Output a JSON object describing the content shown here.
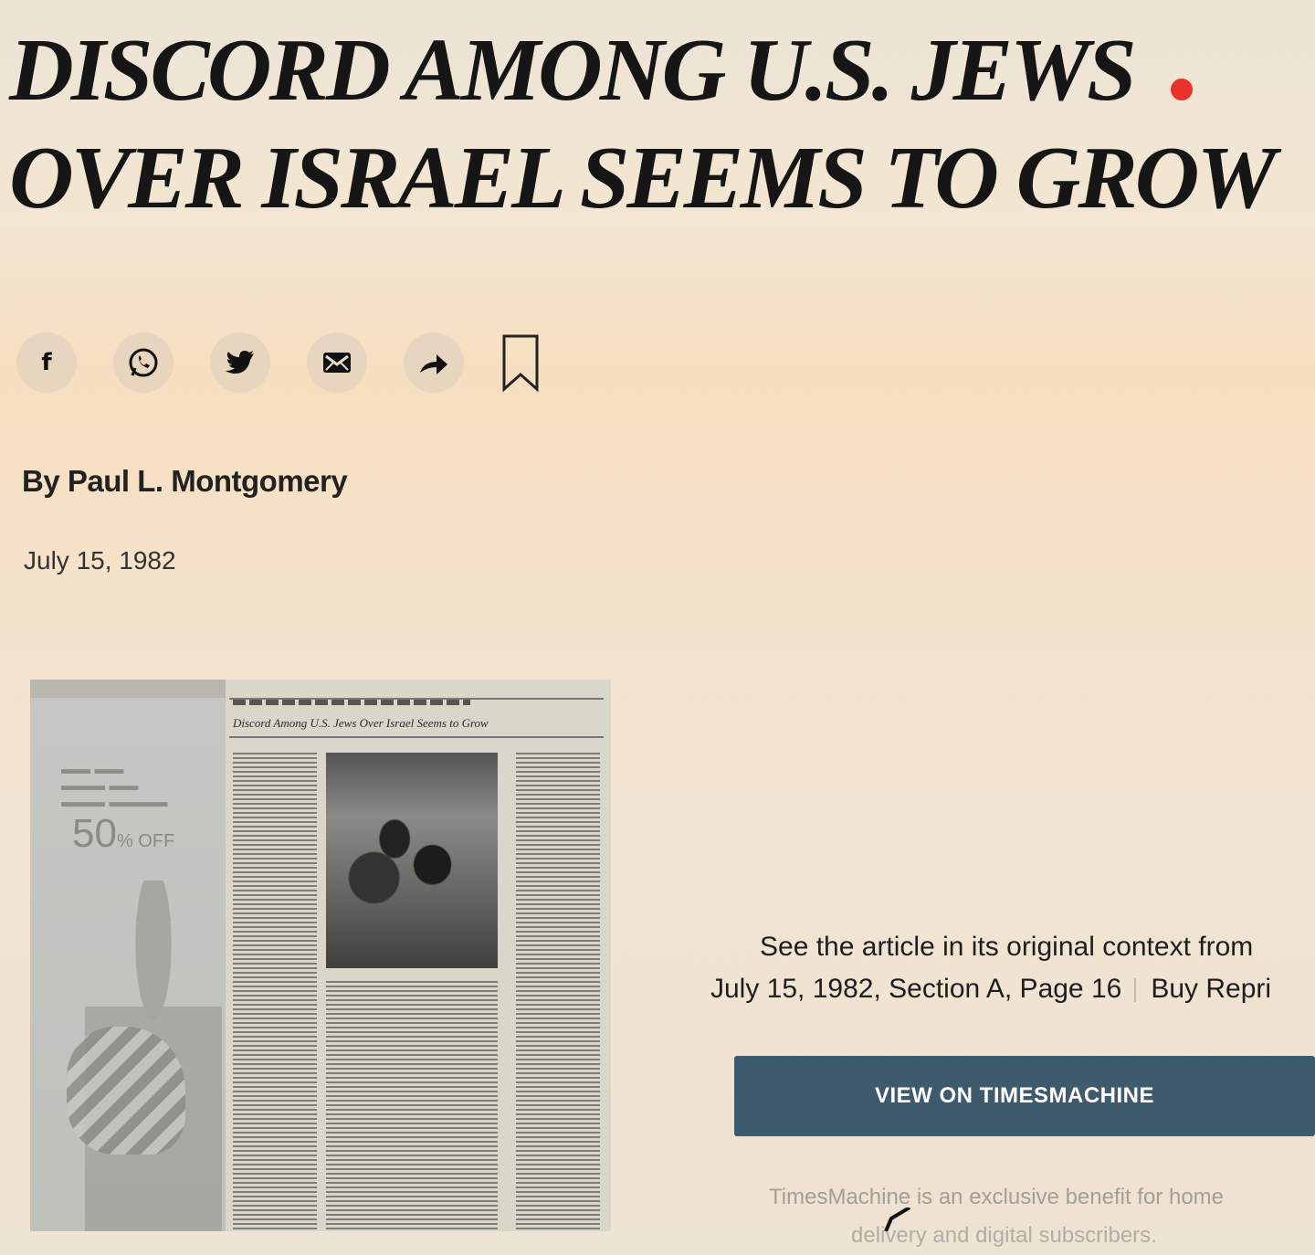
{
  "article": {
    "headline_line1": "DISCORD AMONG U.S. JEWS",
    "headline_line2": "OVER ISRAEL SEEMS TO GROW",
    "byline": "By Paul L. Montgomery",
    "date": "July 15, 1982"
  },
  "share": {
    "facebook_glyph": "f",
    "icons": [
      "facebook-icon",
      "whatsapp-icon",
      "twitter-icon",
      "email-icon",
      "share-arrow-icon",
      "bookmark-icon"
    ]
  },
  "scan": {
    "ad_text": "50",
    "ad_small": "% OFF",
    "newspaper_headline": "Discord Among U.S. Jews Over Israel Seems to Grow"
  },
  "timesmachine": {
    "context_line1": "See the article in its original context from",
    "context_line2": "July 15, 1982, Section A, Page 16",
    "buy_reprints": "Buy Repri",
    "button_label": "VIEW ON TIMESMACHINE",
    "note_line1": "TimesMachine is an exclusive benefit for home",
    "note_line2": "delivery and digital subscribers."
  },
  "colors": {
    "button_bg": "#3e5a6d",
    "live_dot": "#e8332c"
  }
}
